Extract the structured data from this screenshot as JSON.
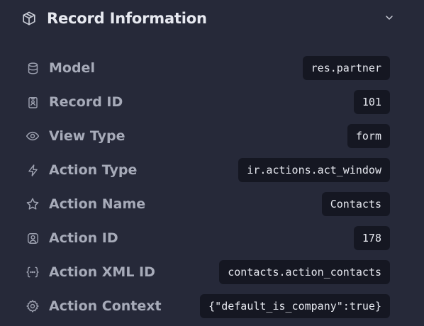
{
  "panel": {
    "title": "Record Information",
    "header_icon": "package-icon",
    "collapse_icon": "chevron-down-icon"
  },
  "rows": [
    {
      "icon": "database-icon",
      "label": "Model",
      "value": "res.partner"
    },
    {
      "icon": "id-badge-icon",
      "label": "Record ID",
      "value": "101"
    },
    {
      "icon": "eye-icon",
      "label": "View Type",
      "value": "form"
    },
    {
      "icon": "bolt-icon",
      "label": "Action Type",
      "value": "ir.actions.act_window"
    },
    {
      "icon": "star-icon",
      "label": "Action Name",
      "value": "Contacts"
    },
    {
      "icon": "user-square-icon",
      "label": "Action ID",
      "value": "178"
    },
    {
      "icon": "braces-icon",
      "label": "Action XML ID",
      "value": "contacts.action_contacts"
    },
    {
      "icon": "gear-icon",
      "label": "Action Context",
      "value": "{\"default_is_company\":true}"
    }
  ],
  "colors": {
    "background": "#262939",
    "value_chip": "#151722",
    "title": "#e7e9f0",
    "label": "#a7abb9"
  }
}
